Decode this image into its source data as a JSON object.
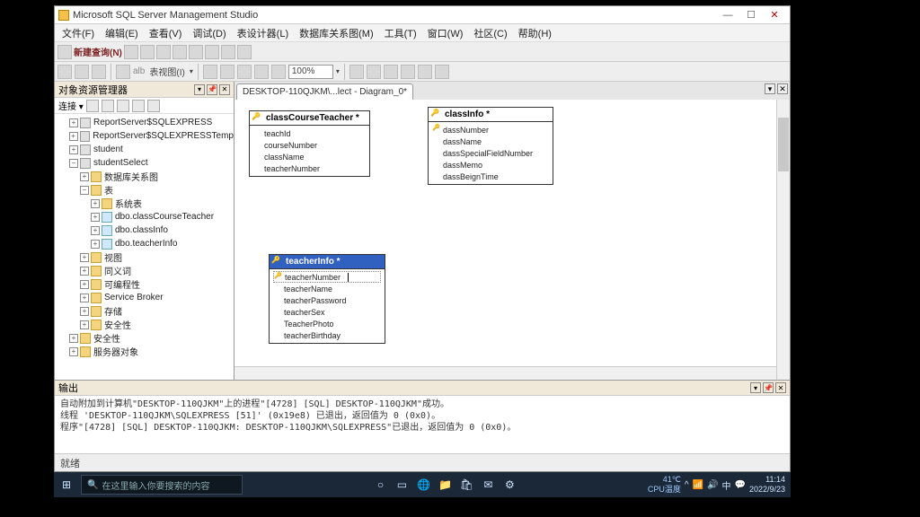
{
  "window": {
    "title": "Microsoft SQL Server Management Studio"
  },
  "menu": {
    "file": "文件(F)",
    "edit": "编辑(E)",
    "view": "查看(V)",
    "debug": "调试(D)",
    "table_designer": "表设计器(L)",
    "db_diagram": "数据库关系图(M)",
    "tools": "工具(T)",
    "window": "窗口(W)",
    "community": "社区(C)",
    "help": "帮助(H)"
  },
  "toolbar": {
    "new_query": "新建查询(N)",
    "table_view": "表视图(I)",
    "alb": "alb",
    "zoom": "100%"
  },
  "sidebar": {
    "title": "对象资源管理器",
    "connect_label": "连接 ▾",
    "tree": {
      "rs1": "ReportServer$SQLEXPRESS",
      "rs2": "ReportServer$SQLEXPRESSTemp",
      "student": "student",
      "studentSelect": "studentSelect",
      "diagrams": "数据库关系图",
      "tables": "表",
      "systables": "系统表",
      "t1": "dbo.classCourseTeacher",
      "t2": "dbo.classInfo",
      "t3": "dbo.teacherInfo",
      "views": "视图",
      "synonyms": "同义词",
      "programmability": "可编程性",
      "servicebroker": "Service Broker",
      "storage": "存储",
      "security": "安全性",
      "security2": "安全性",
      "serverobjects": "服务器对象"
    }
  },
  "tab": {
    "label": "DESKTOP-110QJKM\\...lect - Diagram_0*"
  },
  "diagrams": {
    "classCourseTeacher": {
      "title": "classCourseTeacher *",
      "cols": [
        "teachId",
        "courseNumber",
        "className",
        "teacherNumber"
      ]
    },
    "classInfo": {
      "title": "classInfo *",
      "cols": [
        "dassNumber",
        "dassName",
        "dassSpecialFieldNumber",
        "dassMemo",
        "dassBeignTime"
      ]
    },
    "teacherInfo": {
      "title": "teacherInfo *",
      "cols": [
        "teacherNumber",
        "teacherName",
        "teacherPassword",
        "teacherSex",
        "TeacherPhoto",
        "teacherBirthday"
      ]
    }
  },
  "output": {
    "title": "输出",
    "lines": "自动附加到计算机\"DESKTOP-110QJKM\"上的进程\"[4728] [SQL] DESKTOP-110QJKM\"成功。\n线程 'DESKTOP-110QJKM\\SQLEXPRESS [51]' (0x19e8) 已退出，返回值为 0 (0x0)。\n程序\"[4728] [SQL] DESKTOP-110QJKM: DESKTOP-110QJKM\\SQLEXPRESS\"已退出，返回值为 0 (0x0)。"
  },
  "status": {
    "text": "就绪"
  },
  "taskbar": {
    "search_placeholder": "在这里输入你要搜索的内容",
    "weather_temp": "41℃",
    "weather_label": "CPU温度",
    "time": "11:14",
    "date": "2022/9/23",
    "search_icon": "🔍"
  }
}
